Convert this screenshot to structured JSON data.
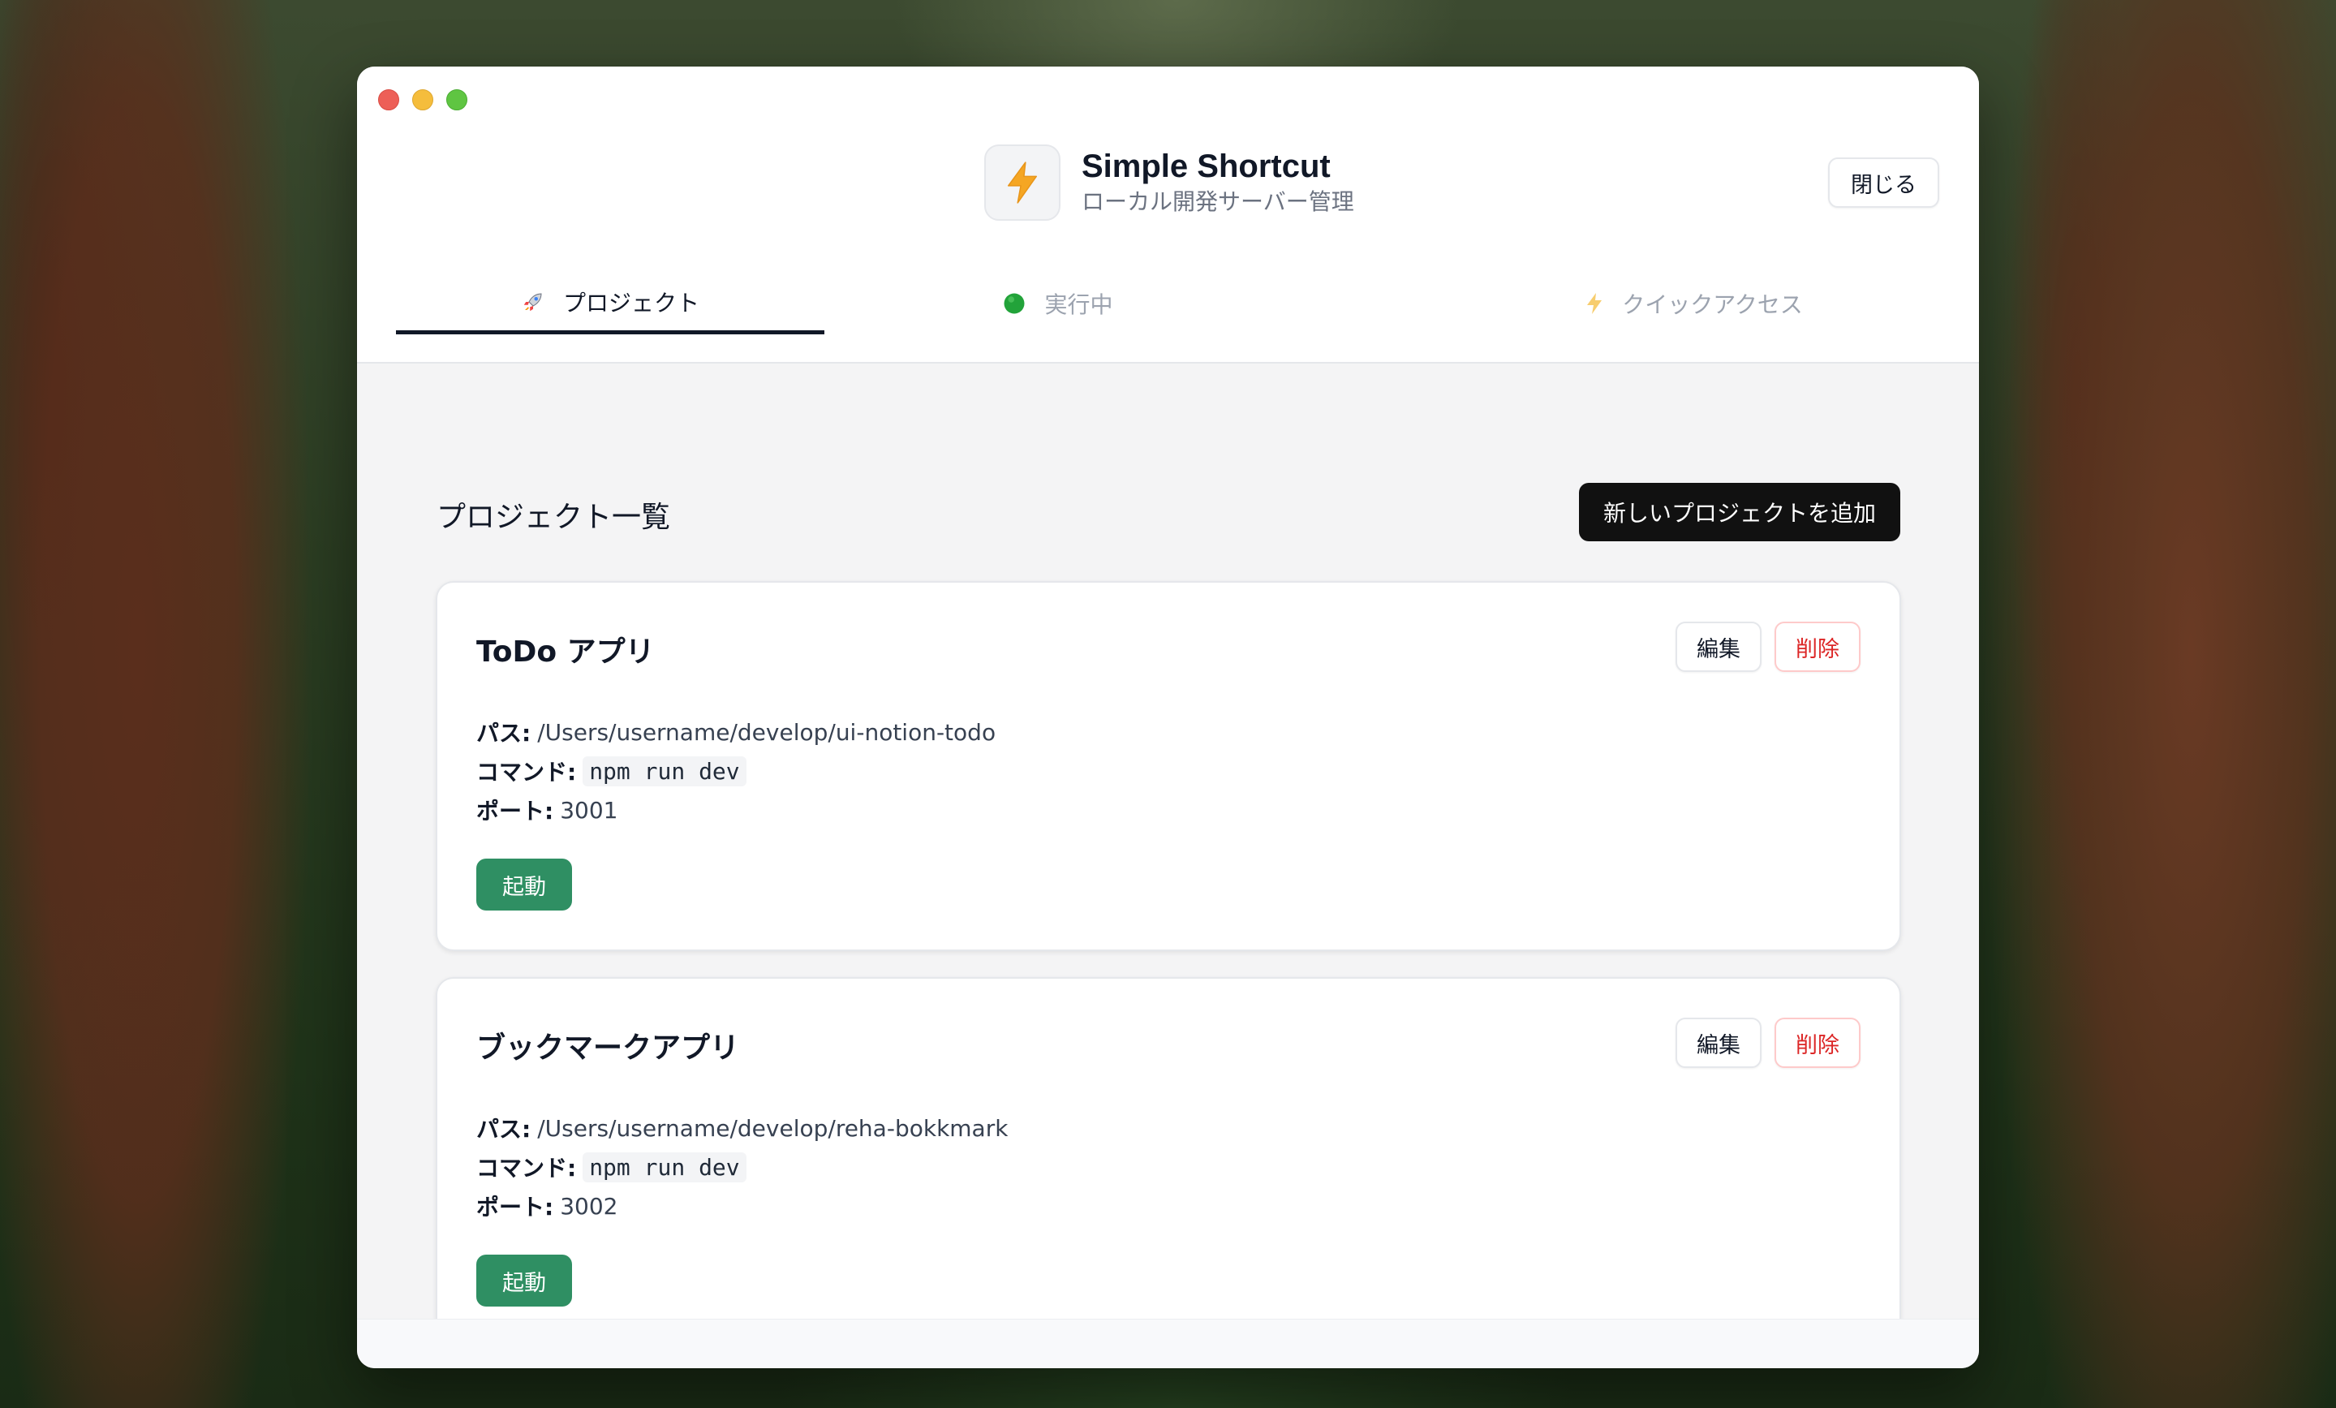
{
  "app": {
    "title": "Simple Shortcut",
    "subtitle": "ローカル開発サーバー管理",
    "close_label": "閉じる"
  },
  "tabs": [
    {
      "label": "プロジェクト",
      "icon": "rocket-icon",
      "active": true
    },
    {
      "label": "実行中",
      "icon": "green-circle-icon",
      "active": false
    },
    {
      "label": "クイックアクセス",
      "icon": "lightning-icon",
      "active": false
    }
  ],
  "main": {
    "section_title": "プロジェクト一覧",
    "add_label": "新しいプロジェクトを追加"
  },
  "labels": {
    "path": "パス:",
    "command": "コマンド:",
    "port": "ポート:",
    "edit": "編集",
    "delete": "削除",
    "start": "起動"
  },
  "projects": [
    {
      "name": "ToDo アプリ",
      "path": "/Users/username/develop/ui-notion-todo",
      "command": "npm run dev",
      "port": "3001"
    },
    {
      "name": "ブックマークアプリ",
      "path": "/Users/username/develop/reha-bokkmark",
      "command": "npm run dev",
      "port": "3002"
    }
  ],
  "colors": {
    "accent_dark": "#111111",
    "start_green": "#2f8f63",
    "delete_red": "#dc2626",
    "logo_bolt": "#f5a623"
  }
}
